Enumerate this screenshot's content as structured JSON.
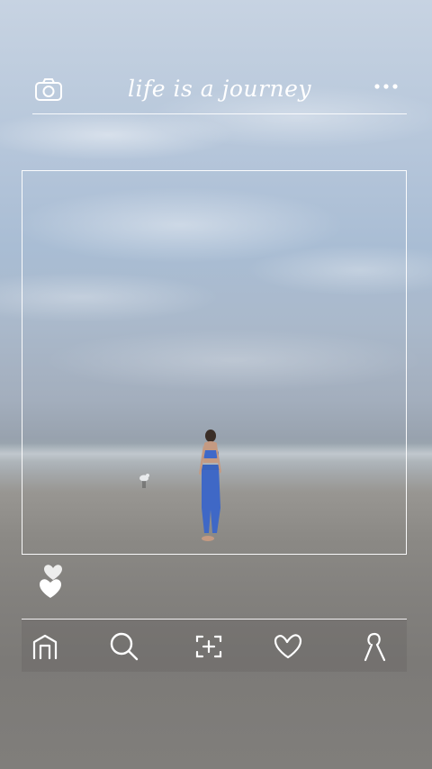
{
  "header": {
    "title": "life is a journey",
    "left_icon": "camera-icon",
    "right_icon": "more-dots-icon"
  },
  "post": {
    "image_description_icon": "photo",
    "liked": true
  },
  "nav": {
    "items": [
      "home-icon",
      "search-icon",
      "add-post-icon",
      "heart-icon",
      "profile-icon"
    ]
  },
  "colors": {
    "outline": "#ffffff",
    "sky": "#b3c4d9",
    "sand": "#8b8985"
  }
}
